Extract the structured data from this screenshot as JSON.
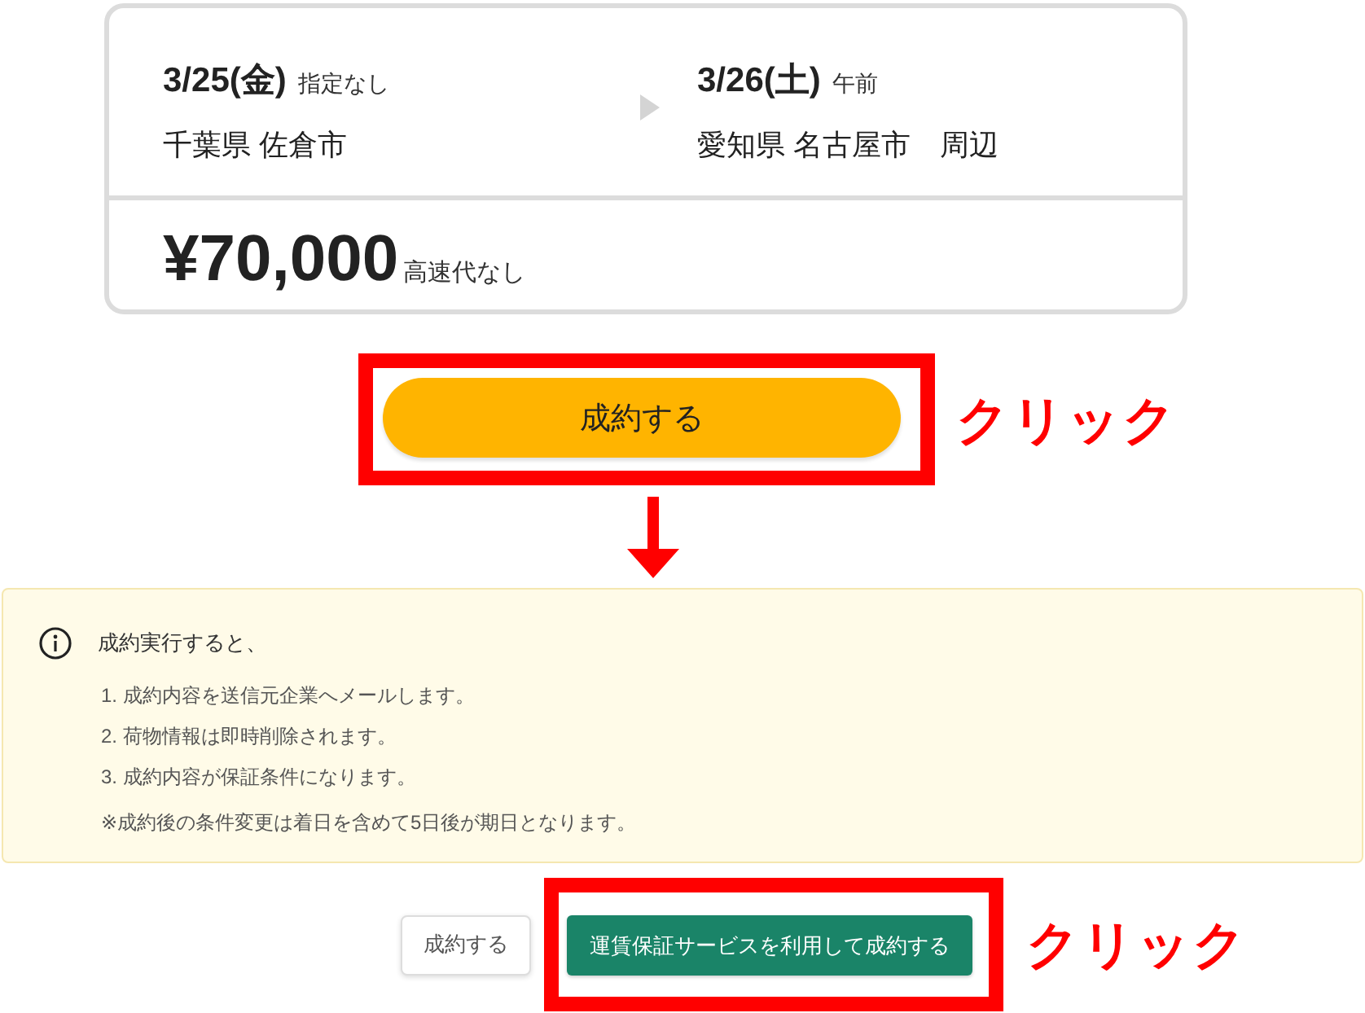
{
  "route_card": {
    "origin": {
      "date": "3/25(金)",
      "time": "指定なし",
      "place": "千葉県 佐倉市"
    },
    "destination": {
      "date": "3/26(土)",
      "time": "午前",
      "place": "愛知県 名古屋市　周辺"
    },
    "price": "¥70,000",
    "price_note": "高速代なし"
  },
  "step_1": {
    "buttons": [
      {
        "label": "成約する",
        "kind": "primary",
        "highlighted": true
      }
    ],
    "callout": "クリック"
  },
  "notice": {
    "title": "成約実行すると、",
    "items": [
      "1. 成約内容を送信元企業へメールします。",
      "2. 荷物情報は即時削除されます。",
      "3. 成約内容が保証条件になります。"
    ],
    "note": "※成約後の条件変更は着日を含めて5日後が期日となります。"
  },
  "step_2": {
    "buttons": [
      {
        "label": "成約する",
        "kind": "secondary",
        "highlighted": false
      },
      {
        "label": "運賃保証サービスを利用して成約する",
        "kind": "confirm",
        "highlighted": true
      }
    ],
    "callout": "クリック"
  }
}
